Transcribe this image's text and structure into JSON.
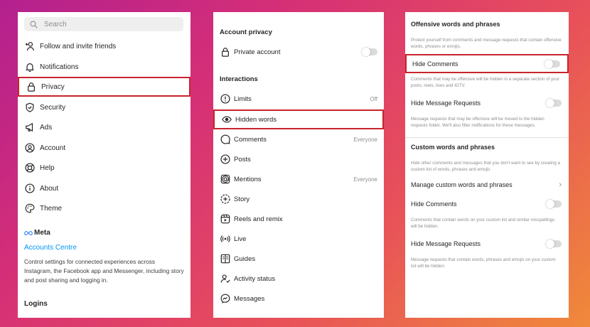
{
  "settings": {
    "search_placeholder": "Search",
    "items": [
      {
        "label": "Follow and invite friends",
        "icon": "add-person-icon"
      },
      {
        "label": "Notifications",
        "icon": "bell-icon"
      },
      {
        "label": "Privacy",
        "icon": "lock-icon"
      },
      {
        "label": "Security",
        "icon": "shield-icon"
      },
      {
        "label": "Ads",
        "icon": "megaphone-icon"
      },
      {
        "label": "Account",
        "icon": "account-icon"
      },
      {
        "label": "Help",
        "icon": "lifebuoy-icon"
      },
      {
        "label": "About",
        "icon": "info-icon"
      },
      {
        "label": "Theme",
        "icon": "palette-icon"
      }
    ],
    "meta_brand": "Meta",
    "accounts_centre": "Accounts Centre",
    "accounts_centre_desc": "Control settings for connected experiences across Instagram, the Facebook app and Messenger, including story and post sharing and logging in.",
    "logins": "Logins"
  },
  "privacy": {
    "account_privacy_title": "Account privacy",
    "private_account": {
      "label": "Private account",
      "icon": "lock-icon",
      "toggle_on": false
    },
    "interactions_title": "Interactions",
    "items": [
      {
        "label": "Limits",
        "value": "Off",
        "icon": "warning-circle-icon"
      },
      {
        "label": "Hidden words",
        "value": "",
        "icon": "eye-icon"
      },
      {
        "label": "Comments",
        "value": "Everyone",
        "icon": "comment-icon"
      },
      {
        "label": "Posts",
        "value": "",
        "icon": "plus-square-icon"
      },
      {
        "label": "Mentions",
        "value": "Everyone",
        "icon": "at-icon"
      },
      {
        "label": "Story",
        "value": "",
        "icon": "story-plus-icon"
      },
      {
        "label": "Reels and remix",
        "value": "",
        "icon": "reels-icon"
      },
      {
        "label": "Live",
        "value": "",
        "icon": "live-icon"
      },
      {
        "label": "Guides",
        "value": "",
        "icon": "guides-icon"
      },
      {
        "label": "Activity status",
        "value": "",
        "icon": "activity-status-icon"
      },
      {
        "label": "Messages",
        "value": "",
        "icon": "messenger-icon"
      }
    ]
  },
  "hidden_words": {
    "offensive_title": "Offensive words and phrases",
    "offensive_desc": "Protect yourself from comments and message requests that contain offensive words, phrases or emojis.",
    "hide_comments": {
      "label": "Hide Comments",
      "toggle_on": false
    },
    "hide_comments_desc": "Comments that may be offensive will be hidden in a separate section of your posts, reels, lives and IGTV.",
    "hide_message_requests": {
      "label": "Hide Message Requests",
      "toggle_on": false
    },
    "hide_message_requests_desc": "Message requests that may be offensive will be moved to the hidden requests folder. We'll also filter notifications for these messages.",
    "custom_title": "Custom words and phrases",
    "custom_desc": "Hide other comments and messages that you don't want to see by creating a custom list of words, phrases and emojis",
    "manage_custom": "Manage custom words and phrases",
    "custom_hide_comments": {
      "label": "Hide Comments",
      "toggle_on": false
    },
    "custom_hide_comments_desc": "Comments that contain words on your custom list and similar misspellings will be hidden.",
    "custom_hide_message_requests": {
      "label": "Hide Message Requests",
      "toggle_on": false
    },
    "custom_hide_message_requests_desc": "Message requests that contain words, phrases and emojis on your custom list will be hidden."
  },
  "colors": {
    "highlight": "#c8232c",
    "link": "#0095f6",
    "toggle_track": "#dbdbdb"
  }
}
